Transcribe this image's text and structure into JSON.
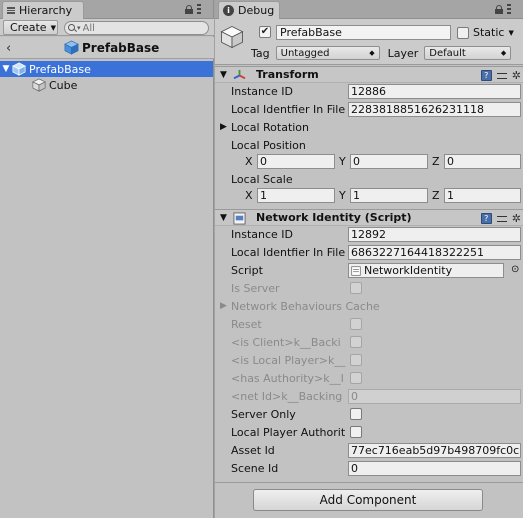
{
  "hierarchy": {
    "tab_label": "Hierarchy",
    "create_label": "Create",
    "search_placeholder": "All",
    "scene_title": "PrefabBase",
    "items": [
      {
        "label": "PrefabBase",
        "selected": true
      },
      {
        "label": "Cube",
        "selected": false
      }
    ]
  },
  "inspector": {
    "tab_label": "Debug",
    "object_name": "PrefabBase",
    "active": true,
    "static_label": "Static",
    "tag_label": "Tag",
    "tag_value": "Untagged",
    "layer_label": "Layer",
    "layer_value": "Default",
    "transform": {
      "title": "Transform",
      "instance_id_label": "Instance ID",
      "instance_id": "12886",
      "local_identifier_label": "Local Identfier In File",
      "local_identifier": "2283818851626231118",
      "local_rotation_label": "Local Rotation",
      "local_position_label": "Local Position",
      "position": {
        "x": "0",
        "y": "0",
        "z": "0"
      },
      "local_scale_label": "Local Scale",
      "scale": {
        "x": "1",
        "y": "1",
        "z": "1"
      },
      "axis_x": "X",
      "axis_y": "Y",
      "axis_z": "Z"
    },
    "network_identity": {
      "title": "Network Identity (Script)",
      "instance_id_label": "Instance ID",
      "instance_id": "12892",
      "local_identifier_label": "Local Identfier In File",
      "local_identifier": "6863227164418322251",
      "script_label": "Script",
      "script_value": "NetworkIdentity",
      "is_server_label": "Is Server",
      "behaviours_cache_label": "Network Behaviours Cache",
      "reset_label": "Reset",
      "is_client_label": "<is Client>k__Backi",
      "is_local_player_label": "<is Local Player>k__",
      "has_authority_label": "<has Authority>k__I",
      "net_id_label": "<net Id>k__Backing",
      "net_id_value": "0",
      "server_only_label": "Server Only",
      "local_player_authority_label": "Local Player Authorit",
      "asset_id_label": "Asset Id",
      "asset_id_value": "77ec716eab5d97b498709fc0c",
      "scene_id_label": "Scene Id",
      "scene_id_value": "0"
    },
    "add_component_label": "Add Component"
  }
}
